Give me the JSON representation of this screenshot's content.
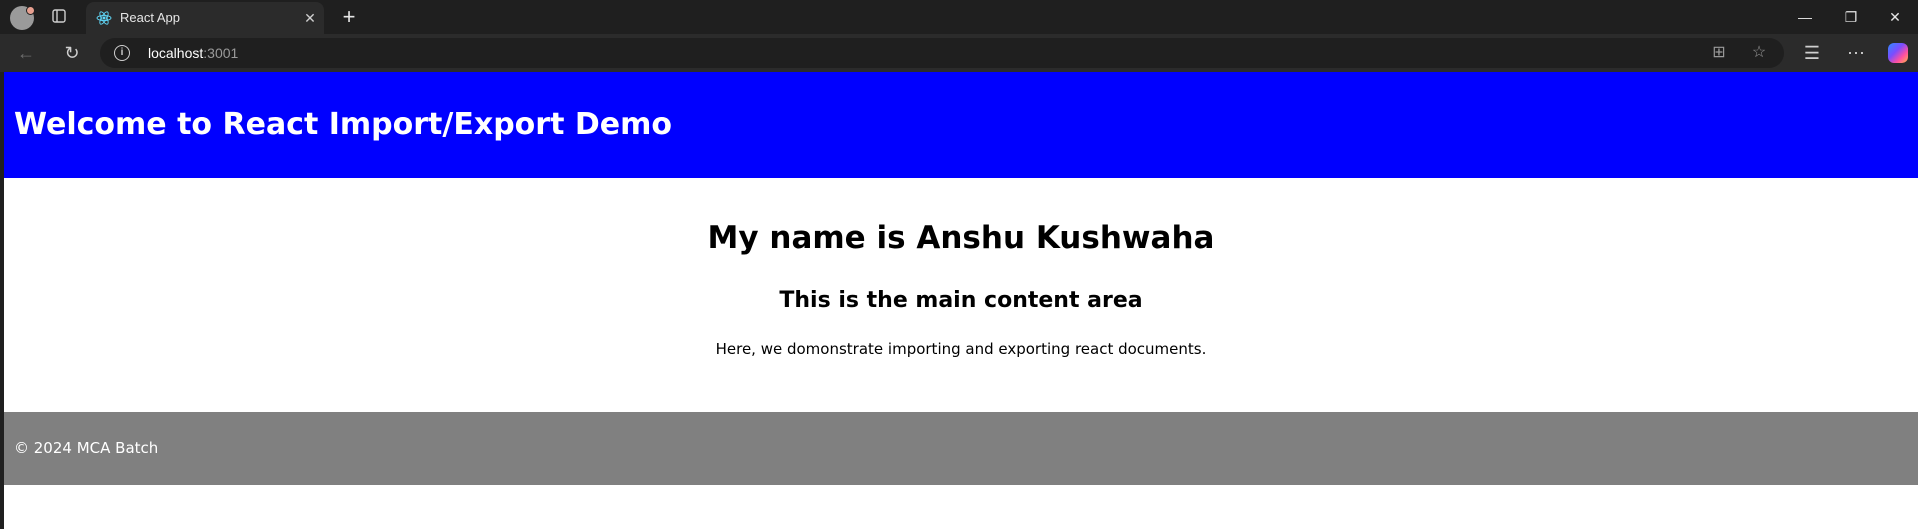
{
  "browser": {
    "tab": {
      "title": "React App",
      "favicon": "react-logo-icon"
    },
    "address": {
      "host": "localhost",
      "port": ":3001"
    },
    "icons": {
      "profile": "profile-avatar-icon",
      "tab_actions": "tab-actions-icon",
      "close_tab": "close-icon",
      "new_tab": "plus-icon",
      "back": "back-arrow-icon",
      "reload": "reload-icon",
      "site_info": "info-icon",
      "app_available": "app-install-icon",
      "favorite": "star-icon",
      "favorites": "favorites-icon",
      "more": "more-icon",
      "copilot": "copilot-icon",
      "minimize": "minimize-icon",
      "restore": "restore-icon",
      "close_window": "close-window-icon"
    },
    "colors": {
      "header_bg": "#0000ff",
      "footer_bg": "#808080"
    }
  },
  "page": {
    "header": {
      "title": "Welcome to React Import/Export Demo"
    },
    "main": {
      "heading": "My name is Anshu Kushwaha",
      "subheading": "This is the main content area",
      "paragraph": "Here, we domonstrate importing and exporting react documents."
    },
    "footer": {
      "text": "© 2024 MCA Batch"
    }
  }
}
